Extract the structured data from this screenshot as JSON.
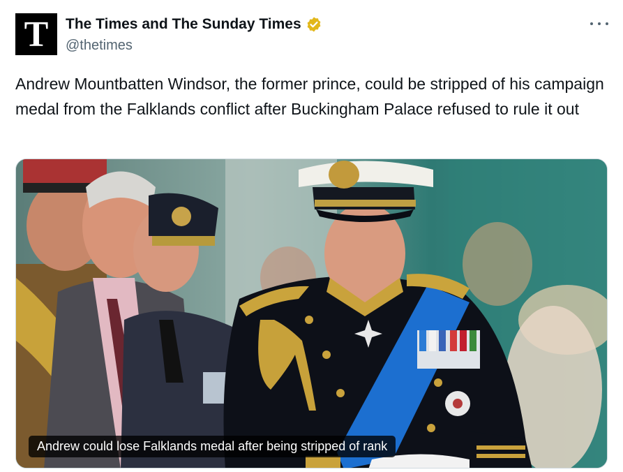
{
  "account": {
    "avatar_letter": "T",
    "display_name": "The Times and The Sunday Times",
    "handle": "@thetimes",
    "verified": true,
    "verified_badge_color": "#e2b719"
  },
  "post": {
    "text": "Andrew Mountbatten Windsor, the former prince, could be stripped of his campaign medal from the Falklands conflict after Buckingham Palace refused to rule it out"
  },
  "media": {
    "caption": "Andrew could lose Falklands medal after being stripped of rank"
  },
  "icons": {
    "more": "more-options-icon",
    "verified": "verified-badge-icon"
  },
  "colors": {
    "text": "#0f1419",
    "secondary": "#536471",
    "sash": "#1c6fd0"
  }
}
